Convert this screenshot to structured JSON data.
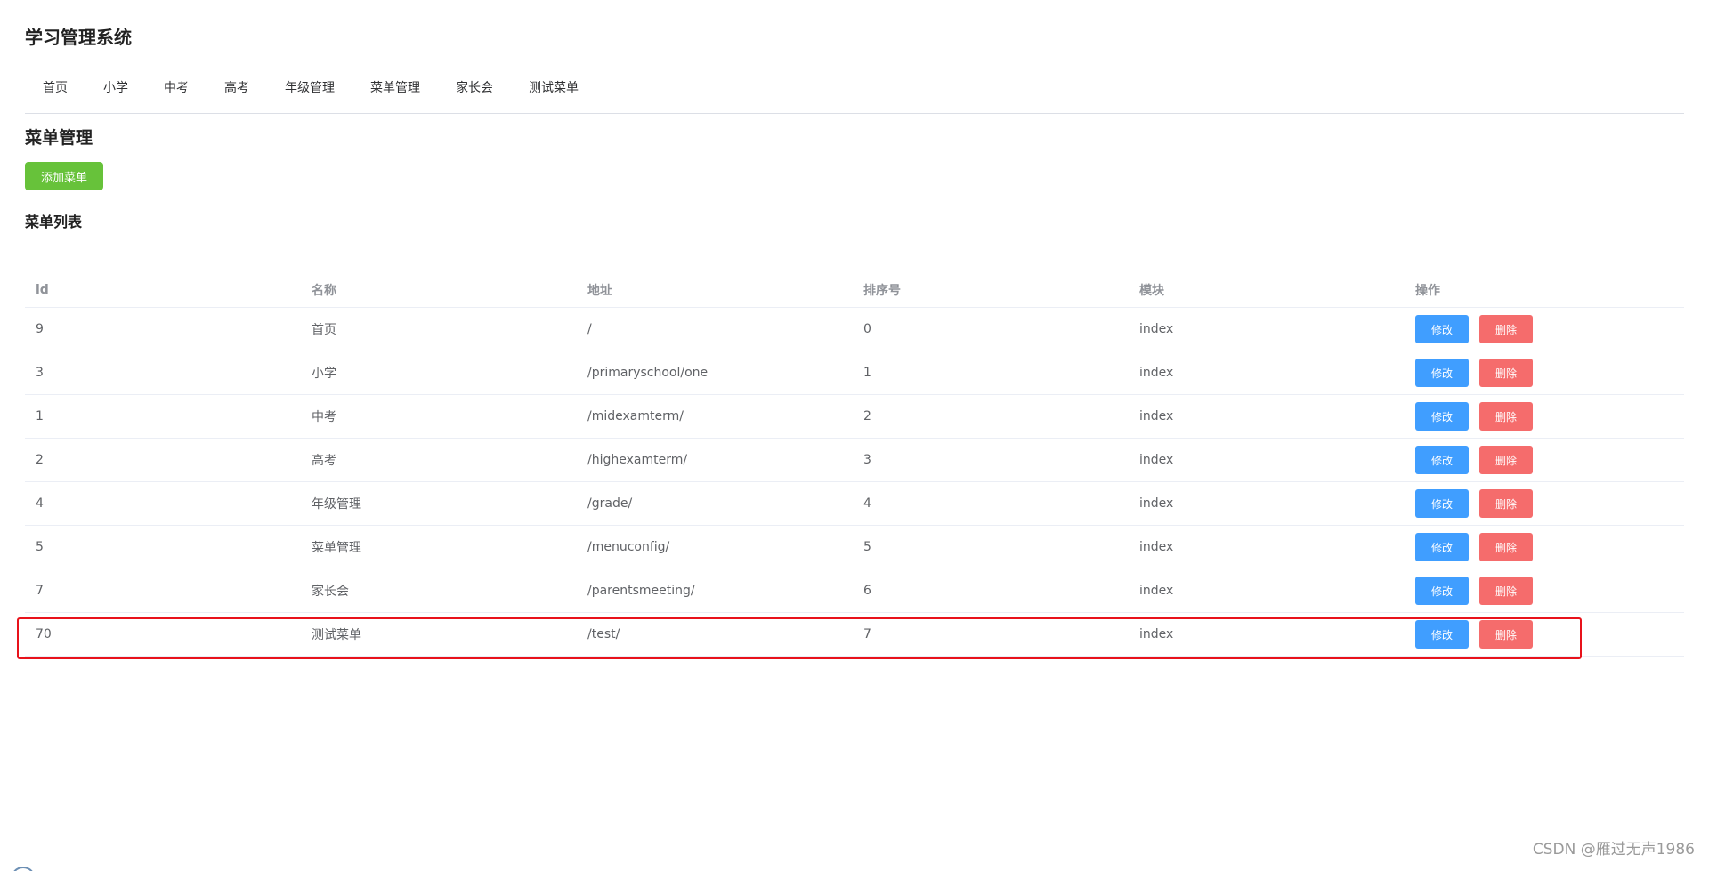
{
  "app_title": "学习管理系统",
  "nav": {
    "items": [
      "首页",
      "小学",
      "中考",
      "高考",
      "年级管理",
      "菜单管理",
      "家长会",
      "测试菜单"
    ]
  },
  "section_title": "菜单管理",
  "add_button_label": "添加菜单",
  "list_title": "菜单列表",
  "table": {
    "headers": {
      "id": "id",
      "name": "名称",
      "path": "地址",
      "sort": "排序号",
      "module": "模块",
      "actions": "操作"
    },
    "rows": [
      {
        "id": "9",
        "name": "首页",
        "path": "/",
        "sort": "0",
        "module": "index"
      },
      {
        "id": "3",
        "name": "小学",
        "path": "/primaryschool/one",
        "sort": "1",
        "module": "index"
      },
      {
        "id": "1",
        "name": "中考",
        "path": "/midexamterm/",
        "sort": "2",
        "module": "index"
      },
      {
        "id": "2",
        "name": "高考",
        "path": "/highexamterm/",
        "sort": "3",
        "module": "index"
      },
      {
        "id": "4",
        "name": "年级管理",
        "path": "/grade/",
        "sort": "4",
        "module": "index"
      },
      {
        "id": "5",
        "name": "菜单管理",
        "path": "/menuconfig/",
        "sort": "5",
        "module": "index"
      },
      {
        "id": "7",
        "name": "家长会",
        "path": "/parentsmeeting/",
        "sort": "6",
        "module": "index"
      },
      {
        "id": "70",
        "name": "测试菜单",
        "path": "/test/",
        "sort": "7",
        "module": "index"
      }
    ],
    "edit_label": "修改",
    "delete_label": "删除"
  },
  "watermark": "CSDN @雁过无声1986",
  "colors": {
    "add_button": "#67c23a",
    "edit_button": "#409eff",
    "delete_button": "#f56c6c",
    "highlight_border": "#e8121b"
  }
}
